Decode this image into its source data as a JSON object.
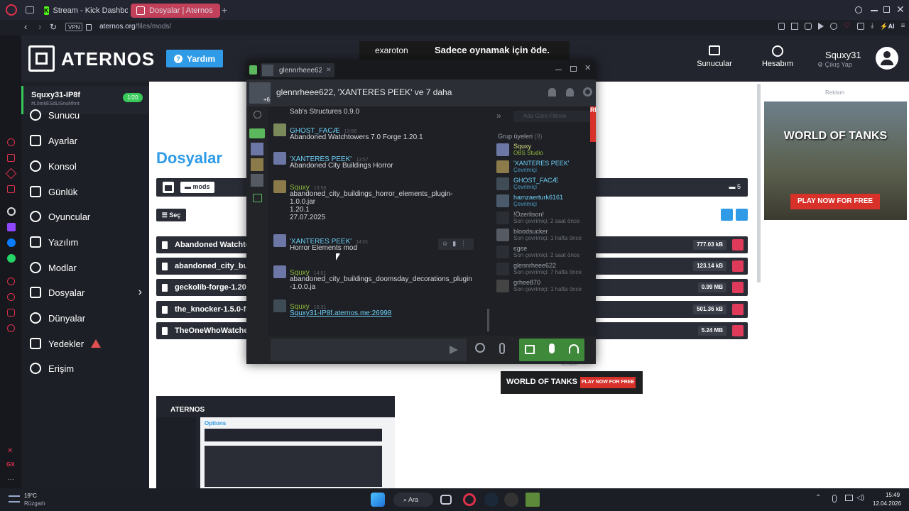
{
  "browser": {
    "tabs": [
      {
        "label": "Stream - Kick Dashboard",
        "active": false
      },
      {
        "label": "Dosyalar | Aternos | Ücretsi",
        "active": true
      }
    ],
    "vpn_label": "VPN",
    "url_host": "aternos.org",
    "url_path": "/files/mods/",
    "ai_label": "AI",
    "icons": [
      "opera-icon",
      "back-icon",
      "forward-icon",
      "reload-icon",
      "lock-icon",
      "search-icon",
      "minimize-icon",
      "maximize-icon",
      "close-icon"
    ]
  },
  "aternos": {
    "logo": "ATERNOS",
    "help_label": "Yardım",
    "ad_banner_left": "exaroton",
    "ad_banner_text": "Sadece oynamak için öde.",
    "nav_servers": "Sunucular",
    "nav_account": "Hesabım",
    "username": "Squxy31",
    "logout_label": "Çıkış Yap",
    "server_name": "Squxy31-IP8f",
    "server_id": "#L0mkESdLiSnuMhnt",
    "server_count": "1/20",
    "sidebar": [
      {
        "label": "Sunucu",
        "icon": "power-icon"
      },
      {
        "label": "Ayarlar",
        "icon": "settings-icon"
      },
      {
        "label": "Konsol",
        "icon": "terminal-icon"
      },
      {
        "label": "Günlük",
        "icon": "log-icon"
      },
      {
        "label": "Oyuncular",
        "icon": "players-icon"
      },
      {
        "label": "Yazılım",
        "icon": "software-icon"
      },
      {
        "label": "Modlar",
        "icon": "puzzle-icon"
      },
      {
        "label": "Dosyalar",
        "icon": "folder-icon"
      },
      {
        "label": "Dünyalar",
        "icon": "globe-icon"
      },
      {
        "label": "Yedekler",
        "icon": "backup-icon"
      },
      {
        "label": "Erişim",
        "icon": "access-icon"
      }
    ],
    "page_title": "Dosyalar",
    "breadcrumb_folder": "mods",
    "folder_count": "5",
    "select_label": "Seç",
    "files": [
      {
        "name": "Abandoned Watchto",
        "size": "777.03 kB"
      },
      {
        "name": "abandoned_city_bu",
        "size": "123.14 kB"
      },
      {
        "name": "geckolib-forge-1.20.",
        "size": "0.99 MB"
      },
      {
        "name": "the_knocker-1.5.0-fo",
        "size": "501.36 kB"
      },
      {
        "name": "TheOneWhoWatche",
        "size": "5.24 MB"
      }
    ],
    "ad_label": "Reklam",
    "ad_label2": "Reklam",
    "wot_logo": "WORLD OF TANKS",
    "wot_cta": "PLAY NOW FOR FREE",
    "wot_small_cta": "PLAY NOW FOR FREE",
    "thumb_logo": "ATERNOS",
    "thumb_heading": "Options",
    "colors": {
      "accent": "#2f9be6",
      "brand_green": "#37c95a",
      "danger": "#e03a5a",
      "steam_green": "#5cb85c"
    }
  },
  "chat": {
    "tab_name": "glennrheee622",
    "avatar_badge": "+6",
    "title": "glennrheee622, 'XANTERES PEEK' ve 7 daha",
    "search_placeholder": "Ada Göre Filtrele",
    "ad_peek": "REE",
    "messages": [
      {
        "name": "",
        "time": "",
        "text": "Sab's Structures 0.9.0",
        "color": "#cdd0d6"
      },
      {
        "name": "GHOST_FACÆ",
        "time": "13:56",
        "text": "Abandoned Watchtowers 7.0 Forge 1.20.1",
        "color": "#6dcff6"
      },
      {
        "name": "'XANTERES PEEK'",
        "time": "13:57",
        "text": "Abandoned City Buildings Horror",
        "color": "#6dcff6"
      },
      {
        "name": "Squxy",
        "time": "13:58",
        "text": "abandoned_city_buildings_horror_elements_plugin-\n1.0.0.jar\n1.20.1\n27.07.2025",
        "color": "#90ba3c"
      },
      {
        "name": "'XANTERES PEEK'",
        "time": "14:01",
        "text": "Horror Elements mod",
        "color": "#6dcff6"
      },
      {
        "name": "Squxy",
        "time": "14:01",
        "text": "abandoned_city_buildings_doomsday_decorations_plugin\n-1.0.0.ja",
        "color": "#90ba3c"
      },
      {
        "name": "Squxy",
        "time": "15:31",
        "text": "Squxy31-IP8f.aternos.me:26998",
        "color": "#90ba3c"
      }
    ],
    "group_label": "Grup üyeleri",
    "group_count": "(9)",
    "members": [
      {
        "name": "Squxy",
        "status": "OBS Studio",
        "name_color": "#d8e27a",
        "status_color": "#90ba3c"
      },
      {
        "name": "'XANTERES PEEK'",
        "status": "Çevrimiçi",
        "name_color": "#6dcff6",
        "status_color": "#4a9fc4"
      },
      {
        "name": "GHOST_FACÆ",
        "status": "Çevrimiçi",
        "name_color": "#6dcff6",
        "status_color": "#4a9fc4"
      },
      {
        "name": "hamzaerturk6161",
        "status": "Çevrimiçi",
        "name_color": "#6dcff6",
        "status_color": "#4a9fc4"
      },
      {
        "name": "!Özerlison!",
        "status": "Son çevrimiçi: 2 saat önce",
        "name_color": "#9ea3ab",
        "status_color": "#6c717a"
      },
      {
        "name": "bloodsucker",
        "status": "Son çevrimiçi: 1 hafta önce",
        "name_color": "#9ea3ab",
        "status_color": "#6c717a"
      },
      {
        "name": "єgєе",
        "status": "Son çevrimiçi: 2 saat önce",
        "name_color": "#9ea3ab",
        "status_color": "#6c717a"
      },
      {
        "name": "glennrheee622",
        "status": "Son çevrimiçi: 7 hafta önce",
        "name_color": "#9ea3ab",
        "status_color": "#6c717a"
      },
      {
        "name": "grhee870",
        "status": "Son çevrimiçi: 1 hafta önce",
        "name_color": "#9ea3ab",
        "status_color": "#6c717a"
      }
    ]
  },
  "taskbar": {
    "weather_temp": "19°C",
    "weather_desc": "Rüzgarlı",
    "search_label": "Ara",
    "time": "15:49",
    "date": "12.04.2026"
  }
}
